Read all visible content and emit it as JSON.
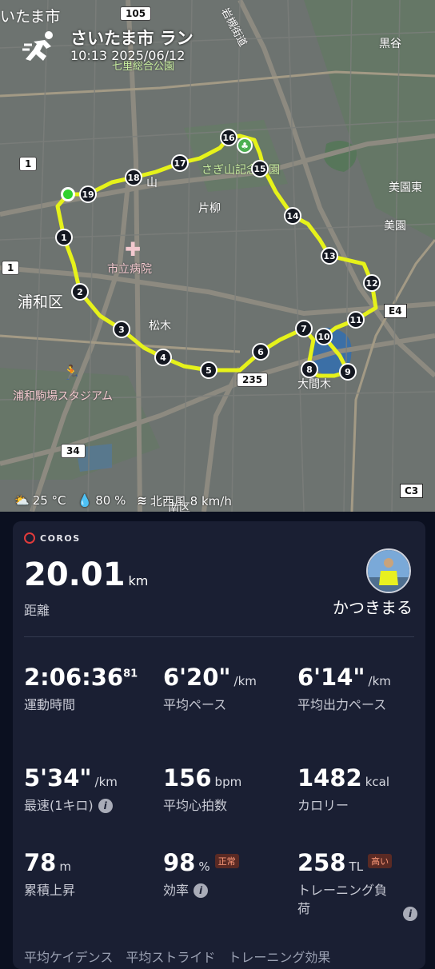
{
  "map": {
    "title": "さいたま市 ラン",
    "datetime": "10:13 2025/06/12",
    "labels": {
      "city_top": "いたま市",
      "park_top": "七里総合公園",
      "iwatsuki": "岩槻街道",
      "kuroya": "黒谷",
      "saginuma": "さぎ山記念公園",
      "katayanagi": "片柳",
      "mizonokuchi": "山",
      "hospital": "市立病院",
      "urawa": "浦和区",
      "matsuki": "松木",
      "stadium": "浦和駒場スタジアム",
      "oomaki": "大間木",
      "mizono1": "美園東",
      "mizono2": "美園",
      "minami": "南区"
    },
    "road_shields": [
      "105",
      "1",
      "1",
      "235",
      "34"
    ],
    "highway_shields": [
      "E4",
      "C3"
    ],
    "weather": {
      "temperature": "25 °C",
      "humidity": "80 %",
      "wind": "北西風 8 km/h"
    },
    "route_markers": [
      "1",
      "2",
      "3",
      "4",
      "5",
      "6",
      "7",
      "8",
      "9",
      "10",
      "11",
      "12",
      "13",
      "14",
      "15",
      "16",
      "17",
      "18",
      "19"
    ],
    "colors": {
      "route": "#e6f21a",
      "start": "#2fd12f"
    }
  },
  "card": {
    "brand": "COROS",
    "distance": {
      "value": "20.01",
      "unit": "km",
      "label": "距離"
    },
    "username": "かつきまる",
    "metrics": [
      {
        "value": "2:06:36",
        "sup": "81",
        "unit": "",
        "label": "運動時間"
      },
      {
        "value": "6'20\"",
        "unit": "/km",
        "label": "平均ペース"
      },
      {
        "value": "6'14\"",
        "unit": "/km",
        "label": "平均出力ペース"
      },
      {
        "value": "5'34\"",
        "unit": "/km",
        "label": "最速(1キロ)"
      },
      {
        "value": "156",
        "unit": "bpm",
        "label": "平均心拍数"
      },
      {
        "value": "1482",
        "unit": "kcal",
        "label": "カロリー"
      },
      {
        "value": "78",
        "unit": "m",
        "label": "累積上昇"
      },
      {
        "value": "98",
        "unit": "%",
        "badge": "正常",
        "label": "効率"
      },
      {
        "value": "258",
        "unit": "TL",
        "badge": "高い",
        "label": "トレーニング負荷"
      }
    ],
    "bottom_clip": "平均ケイデンス　平均ストライド　トレーニング効果"
  }
}
